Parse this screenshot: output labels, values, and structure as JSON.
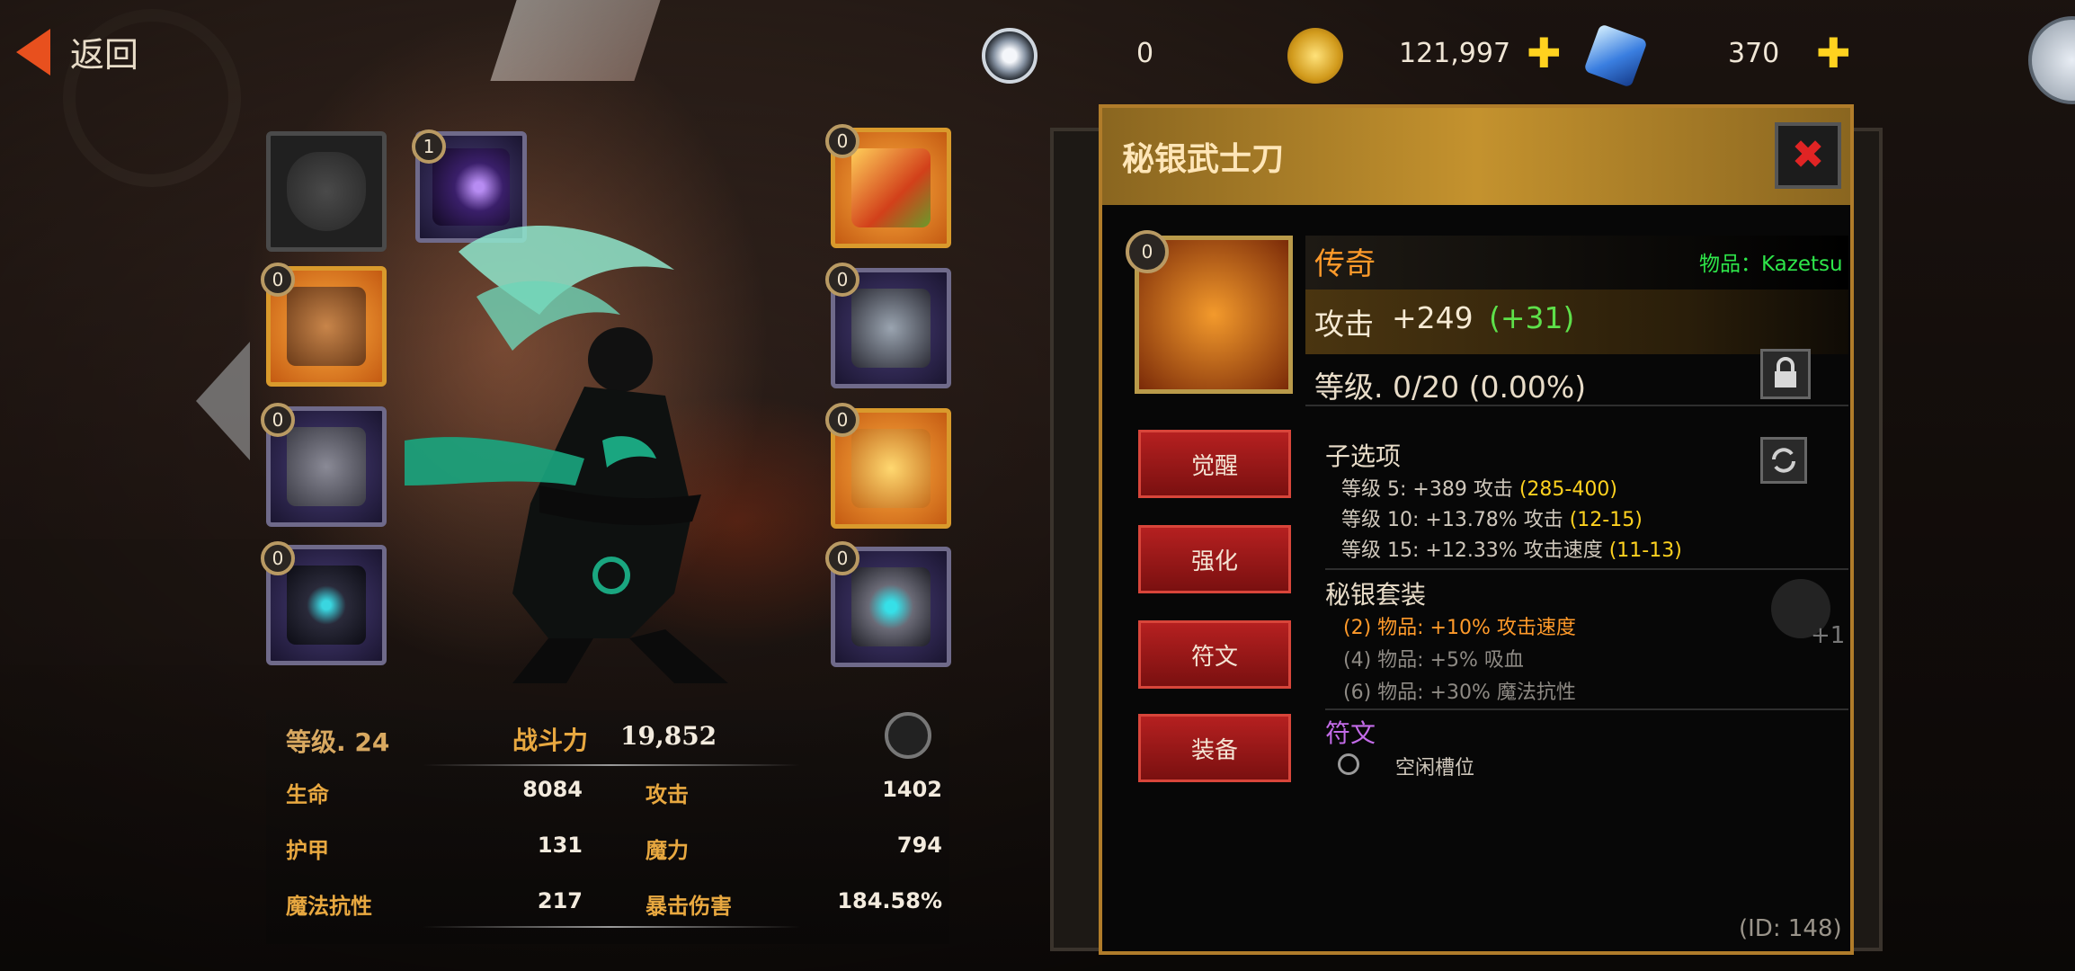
{
  "back_label": "返回",
  "currencies": [
    {
      "icon": "spiral-token-icon",
      "value": "0"
    },
    {
      "icon": "gold-coin-icon",
      "value": "121,997"
    },
    {
      "icon": "crystal-icon",
      "value": "370"
    }
  ],
  "slots": {
    "portrait_badge": "1",
    "left": [
      "0",
      "0",
      "0"
    ],
    "right": [
      "0",
      "0",
      "0",
      "0"
    ]
  },
  "stats": {
    "level_label": "等级. 24",
    "power_label": "战斗力",
    "power_value": "19,852",
    "rows": [
      {
        "l_label": "生命",
        "l_value": "8084",
        "r_label": "攻击",
        "r_value": "1402"
      },
      {
        "l_label": "护甲",
        "l_value": "131",
        "r_label": "魔力",
        "r_value": "794"
      },
      {
        "l_label": "魔法抗性",
        "l_value": "217",
        "r_label": "暴击伤害",
        "r_value": "184.58%"
      }
    ]
  },
  "item": {
    "title": "秘银武士刀",
    "badge": "0",
    "rarity": "传奇",
    "item_name": "物品：Kazetsu",
    "atk_label": "攻击",
    "atk_base": "+249",
    "atk_bonus": "(+31)",
    "level_text": "等级. 0/20 (0.00%)",
    "buttons": [
      "觉醒",
      "强化",
      "符文",
      "装备"
    ],
    "suboptions_title": "子选项",
    "suboptions": [
      {
        "text": "等级 5: +389 攻击 ",
        "range": "(285-400)"
      },
      {
        "text": "等级 10: +13.78% 攻击 ",
        "range": "(12-15)"
      },
      {
        "text": "等级 15: +12.33% 攻击速度 ",
        "range": "(11-13)"
      }
    ],
    "set_title": "秘银套装",
    "set_bonuses": [
      "(2) 物品: +10% 攻击速度",
      "(4) 物品: +5% 吸血",
      "(6) 物品: +30% 魔法抗性"
    ],
    "set_count": "+1",
    "rune_title": "符文",
    "rune_empty": "空闲槽位",
    "id_text": "(ID: 148)"
  },
  "colors": {
    "accent_gold": "#c4922e",
    "legendary": "#ff9a2a",
    "bonus_green": "#5ee04a",
    "range_yellow": "#ffd21f",
    "rune_purple": "#c36be8",
    "button_red": "#b52020"
  }
}
